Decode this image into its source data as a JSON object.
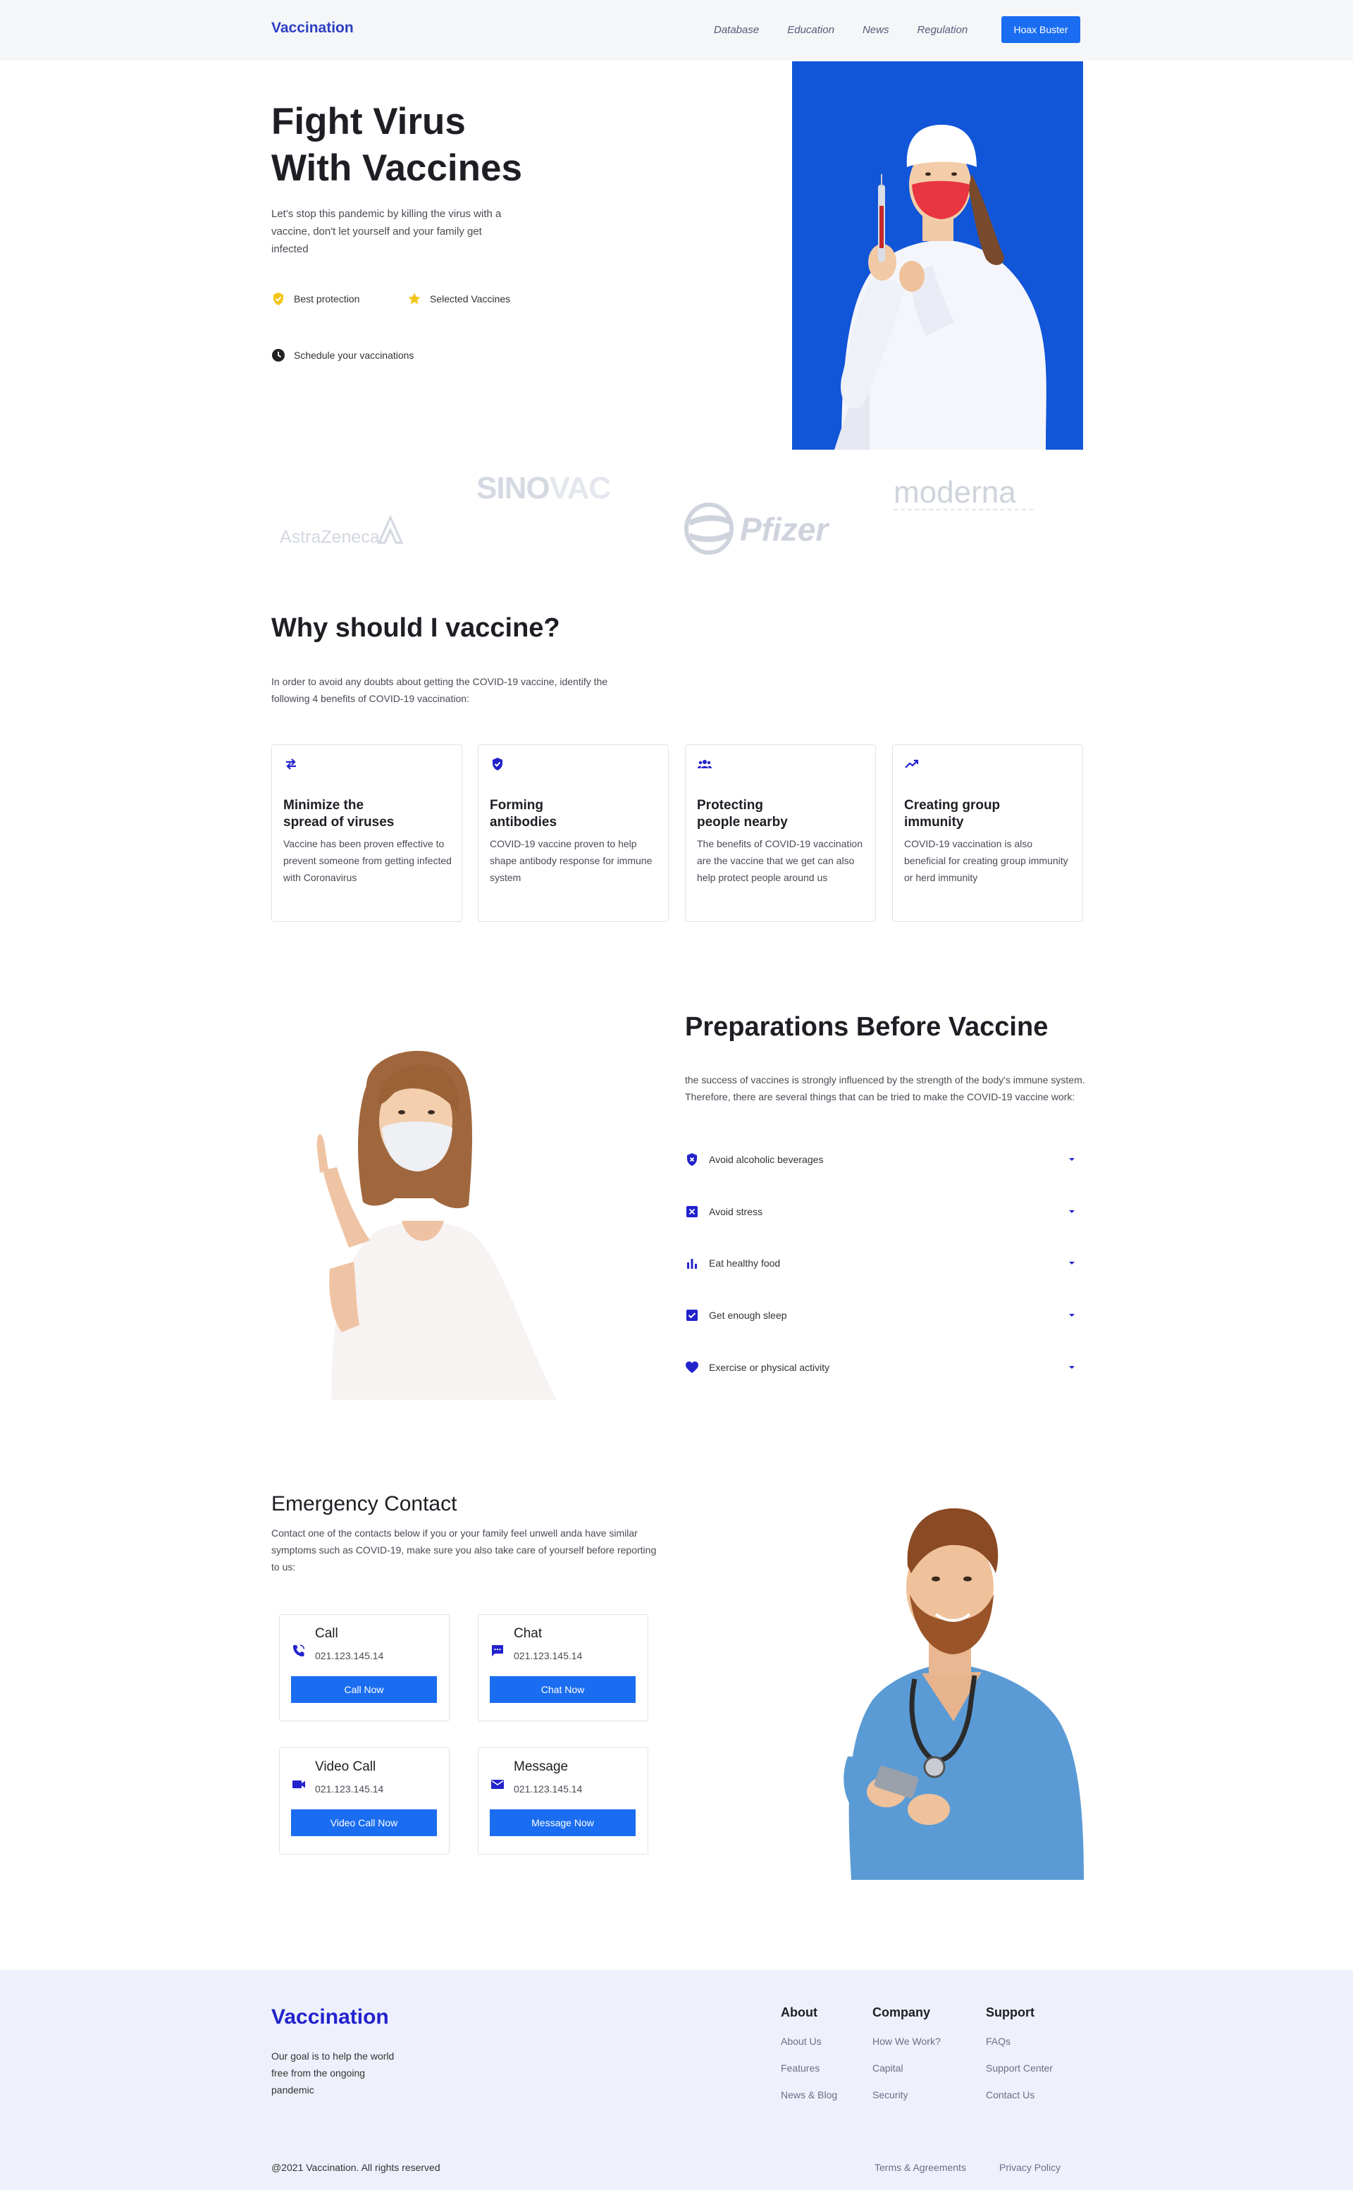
{
  "nav": {
    "brand": "Vaccination",
    "links": [
      "Database",
      "Education",
      "News",
      "Regulation"
    ],
    "cta": "Hoax Buster"
  },
  "hero": {
    "title_line1": "Fight Virus",
    "title_line2": "With Vaccines",
    "description": "Let's stop this pandemic by killing the virus with a vaccine, don't let yourself and your family get infected",
    "features": [
      "Best protection",
      "Selected Vaccines",
      "Schedule your vaccinations"
    ]
  },
  "brands": {
    "sinovac_a": "SINO",
    "sinovac_b": "VAC",
    "moderna": "moderna",
    "astrazeneca": "AstraZeneca",
    "pfizer": "Pfizer"
  },
  "why": {
    "title": "Why should I vaccine?",
    "description": "In order to avoid any doubts about getting the COVID-19 vaccine, identify the following 4 benefits of COVID-19 vaccination:",
    "cards": [
      {
        "icon": "arrows-exchange-icon",
        "title_line1": "Minimize the",
        "title_line2": "spread of viruses",
        "desc": "Vaccine has been proven effective to prevent someone from getting infected with Coronavirus"
      },
      {
        "icon": "shield-icon",
        "title_line1": "Forming",
        "title_line2": "antibodies",
        "desc": "COVID-19 vaccine proven to help shape antibody response for immune system"
      },
      {
        "icon": "people-icon",
        "title_line1": "Protecting",
        "title_line2": "people nearby",
        "desc": "The benefits of COVID-19 vaccination are the vaccine that we get can also help protect people around us"
      },
      {
        "icon": "trending-up-icon",
        "title_line1": "Creating group",
        "title_line2": "immunity",
        "desc": "COVID-19 vaccination is also beneficial for creating group immunity or herd immunity"
      }
    ]
  },
  "prep": {
    "title": "Preparations Before Vaccine",
    "description": "the success of vaccines is strongly influenced by the strength of the body's immune system. Therefore, there are several things that can be tried to make the COVID-19 vaccine work:",
    "items": [
      {
        "icon": "shield-x-icon",
        "label": "Avoid alcoholic beverages"
      },
      {
        "icon": "close-box-icon",
        "label": "Avoid stress"
      },
      {
        "icon": "bar-chart-icon",
        "label": "Eat healthy food"
      },
      {
        "icon": "check-box-icon",
        "label": "Get enough sleep"
      },
      {
        "icon": "heart-icon",
        "label": "Exercise or physical activity"
      }
    ]
  },
  "emergency": {
    "title": "Emergency Contact",
    "description": "Contact one of the contacts below if you or your family feel unwell anda have similar symptoms such as COVID-19, make sure you also take care of yourself before reporting to us:",
    "contacts": [
      {
        "icon": "phone-icon",
        "name": "Call",
        "number": "021.123.145.14",
        "button": "Call Now"
      },
      {
        "icon": "chat-icon",
        "name": "Chat",
        "number": "021.123.145.14",
        "button": "Chat Now"
      },
      {
        "icon": "video-icon",
        "name": "Video Call",
        "number": "021.123.145.14",
        "button": "Video Call Now"
      },
      {
        "icon": "mail-icon",
        "name": "Message",
        "number": "021.123.145.14",
        "button": "Message Now"
      }
    ]
  },
  "footer": {
    "brand": "Vaccination",
    "description": "Our goal is to help the world free from the ongoing pandemic",
    "columns": [
      {
        "heading": "About",
        "links": [
          "About Us",
          "Features",
          "News & Blog"
        ]
      },
      {
        "heading": "Company",
        "links": [
          "How We Work?",
          "Capital",
          "Security"
        ]
      },
      {
        "heading": "Support",
        "links": [
          "FAQs",
          "Support Center",
          "Contact Us"
        ]
      }
    ],
    "copyright": "@2021 Vaccination. All rights reserved",
    "legal": [
      "Terms & Agreements",
      "Privacy Policy"
    ]
  },
  "colors": {
    "accent": "#1a6df0",
    "brand": "#2b3fc4",
    "icon_blue": "#2222cc",
    "star": "#f5c518",
    "hero_bg": "#1155d8",
    "footer_bg": "#eef1fb"
  }
}
